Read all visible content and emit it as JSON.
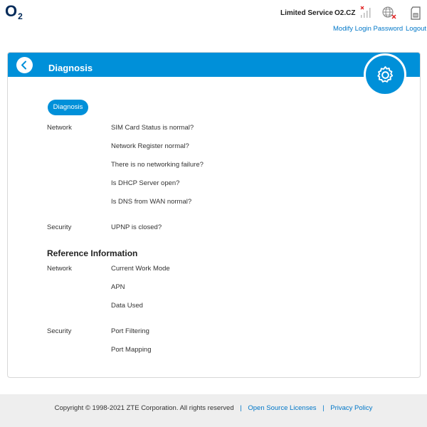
{
  "header": {
    "logo": "O",
    "logo_sub": "2",
    "service_status": "Limited Service",
    "operator": "O2.CZ",
    "links": {
      "modify_password": "Modify Login Password",
      "logout": "Logout"
    }
  },
  "panel": {
    "title": "Diagnosis",
    "diagnosis_button": "Diagnosis",
    "diagnosis_groups": [
      {
        "label": "Network",
        "items": [
          "SIM Card Status is normal?",
          "Network Register normal?",
          "There is no networking failure?",
          "Is DHCP Server open?",
          "Is DNS from WAN normal?"
        ]
      },
      {
        "label": "Security",
        "items": [
          "UPNP is closed?"
        ]
      }
    ],
    "reference_heading": "Reference Information",
    "reference_groups": [
      {
        "label": "Network",
        "items": [
          "Current Work Mode",
          "APN",
          "Data Used"
        ]
      },
      {
        "label": "Security",
        "items": [
          "Port Filtering",
          "Port Mapping"
        ]
      }
    ]
  },
  "footer": {
    "copyright": "Copyright © 1998-2021 ZTE Corporation. All rights reserved",
    "separator": "|",
    "open_source": "Open Source Licenses",
    "privacy": "Privacy Policy"
  },
  "colors": {
    "accent": "#0090d9",
    "link": "#0077c8",
    "logo": "#032b5a",
    "error": "#e02020"
  }
}
